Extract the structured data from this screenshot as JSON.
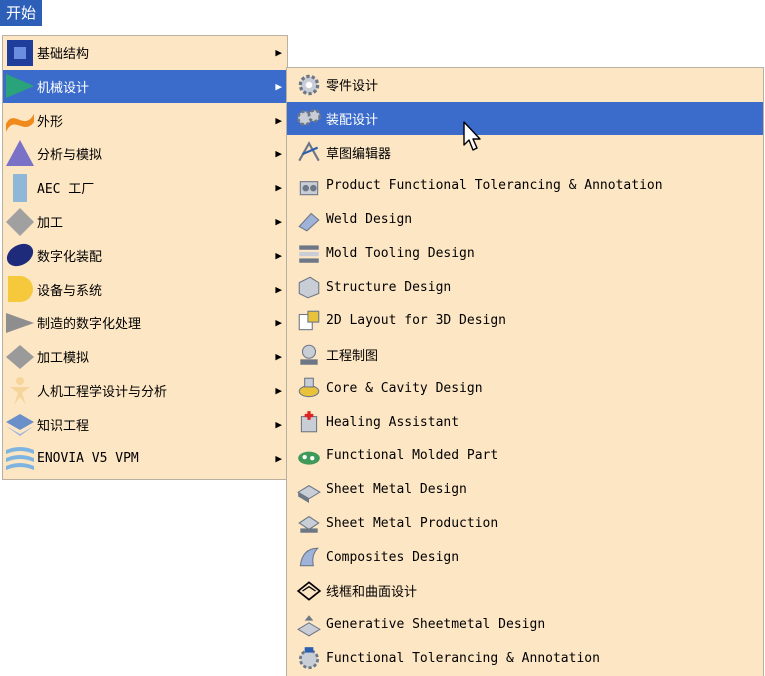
{
  "start_button": {
    "label": "开始"
  },
  "main_menu": {
    "items": [
      {
        "label": "基础结构",
        "icon": "infrastructure-icon",
        "color": "#1f3e9c"
      },
      {
        "label": "机械设计",
        "icon": "mechanical-design-icon",
        "color": "#2aa37a",
        "selected": true
      },
      {
        "label": "外形",
        "icon": "shape-icon",
        "color": "#f08a1c"
      },
      {
        "label": "分析与模拟",
        "icon": "analysis-icon",
        "color": "#7a72c6"
      },
      {
        "label": "AEC 工厂",
        "icon": "aec-plant-icon",
        "color": "#8fb8d8"
      },
      {
        "label": "加工",
        "icon": "machining-icon",
        "color": "#a0a0a0"
      },
      {
        "label": "数字化装配",
        "icon": "digital-mockup-icon",
        "color": "#1d2b7a"
      },
      {
        "label": "设备与系统",
        "icon": "equipment-icon",
        "color": "#f5c93b"
      },
      {
        "label": "制造的数字化处理",
        "icon": "digital-process-icon",
        "color": "#8e8e8e"
      },
      {
        "label": "加工模拟",
        "icon": "machining-simulation-icon",
        "color": "#9a9a9a"
      },
      {
        "label": "人机工程学设计与分析",
        "icon": "ergonomics-icon",
        "color": "#f5d59a"
      },
      {
        "label": "知识工程",
        "icon": "knowledgeware-icon",
        "color": "#6b8fc9"
      },
      {
        "label": "ENOVIA V5 VPM",
        "icon": "enovia-icon",
        "color": "#7fb3e0"
      }
    ],
    "arrow": "▶"
  },
  "sub_menu": {
    "items": [
      {
        "label": "零件设计",
        "icon": "part-design-icon"
      },
      {
        "label": "装配设计",
        "icon": "assembly-design-icon",
        "selected": true
      },
      {
        "label": "草图编辑器",
        "icon": "sketcher-icon"
      },
      {
        "label": "Product Functional Tolerancing & Annotation",
        "icon": "product-tolerancing-icon"
      },
      {
        "label": "Weld Design",
        "icon": "weld-design-icon"
      },
      {
        "label": "Mold Tooling Design",
        "icon": "mold-tooling-icon"
      },
      {
        "label": "Structure Design",
        "icon": "structure-design-icon"
      },
      {
        "label": "2D Layout for 3D Design",
        "icon": "2d-layout-icon"
      },
      {
        "label": "工程制图",
        "icon": "drafting-icon"
      },
      {
        "label": "Core & Cavity Design",
        "icon": "core-cavity-icon"
      },
      {
        "label": "Healing Assistant",
        "icon": "healing-assistant-icon"
      },
      {
        "label": "Functional Molded Part",
        "icon": "functional-molded-part-icon"
      },
      {
        "label": "Sheet Metal Design",
        "icon": "sheet-metal-design-icon"
      },
      {
        "label": "Sheet Metal Production",
        "icon": "sheet-metal-production-icon"
      },
      {
        "label": "Composites Design",
        "icon": "composites-design-icon"
      },
      {
        "label": "线框和曲面设计",
        "icon": "wireframe-surface-icon"
      },
      {
        "label": "Generative Sheetmetal Design",
        "icon": "generative-sheetmetal-icon"
      },
      {
        "label": "Functional Tolerancing & Annotation",
        "icon": "functional-tolerancing-icon"
      }
    ]
  }
}
